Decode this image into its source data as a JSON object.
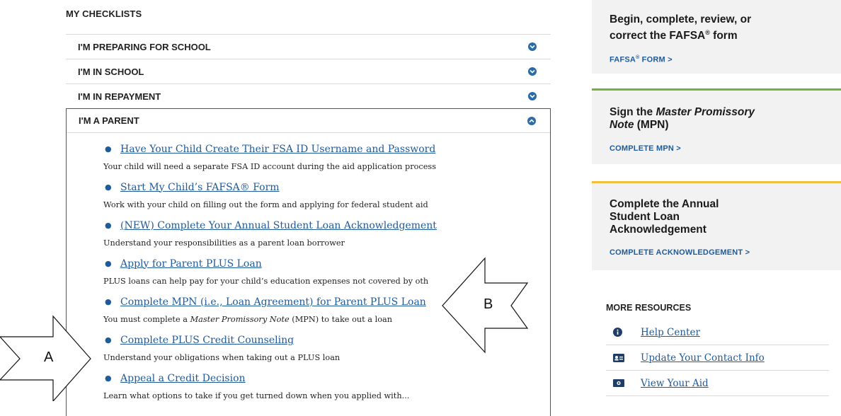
{
  "checklists": {
    "title": "MY CHECKLISTS",
    "sections": [
      {
        "label": "I'M PREPARING FOR SCHOOL"
      },
      {
        "label": "I'M IN SCHOOL"
      },
      {
        "label": "I'M IN REPAYMENT"
      }
    ],
    "parent": {
      "label": "I'M A PARENT",
      "items": [
        {
          "link": "Have Your Child Create Their FSA ID Username and Password",
          "desc": "Your child will need a separate FSA ID account during the aid application process"
        },
        {
          "link": "Start My Child’s FAFSA® Form",
          "desc": "Work with your child on filling out the form and applying for federal student aid"
        },
        {
          "link": "(NEW) Complete Your Annual Student Loan Acknowledgement",
          "desc": "Understand your responsibilities as a parent loan borrower"
        },
        {
          "link": "Apply for Parent PLUS Loan",
          "desc": "PLUS loans can help pay for your child’s education expenses not covered by oth"
        },
        {
          "link": "Complete MPN (i.e., Loan Agreement) for Parent PLUS Loan",
          "desc_pre": "You must complete a ",
          "desc_em": "Master Promissory Note",
          "desc_post": " (MPN) to take out a loan"
        },
        {
          "link": "Complete PLUS Credit Counseling",
          "desc": "Understand your obligations when taking out a PLUS loan"
        },
        {
          "link": "Appeal a Credit Decision",
          "desc": "Learn what options to take if you get turned down when you applied with..."
        }
      ]
    }
  },
  "cards": {
    "fafsa": {
      "title_line1": "Begin, complete, review, or",
      "title_line2": "correct the FAFSA",
      "title_reg": "®",
      "title_tail": " form",
      "link": "FAFSA",
      "link_reg": "®",
      "link_tail": " FORM >"
    },
    "mpn": {
      "title_pre": "Sign the ",
      "title_em": "Master Promissory",
      "title_em2": "Note",
      "title_post": " (MPN)",
      "link": "COMPLETE MPN >"
    },
    "ack": {
      "line1": "Complete the Annual",
      "line2": "Student Loan",
      "line3": "Acknowledgement",
      "link": "COMPLETE ACKNOWLEDGEMENT >"
    }
  },
  "resources": {
    "title": "MORE RESOURCES",
    "items": [
      {
        "label": "Help Center",
        "icon": "info-icon"
      },
      {
        "label": "Update Your Contact Info",
        "icon": "id-card-icon"
      },
      {
        "label": "View Your Aid",
        "icon": "money-icon"
      }
    ]
  },
  "annotations": {
    "a": "A",
    "b": "B"
  },
  "colors": {
    "link": "#1f5a99",
    "green": "#72b340",
    "yellow": "#f2c13c",
    "card_bg": "#f2f2f2"
  }
}
